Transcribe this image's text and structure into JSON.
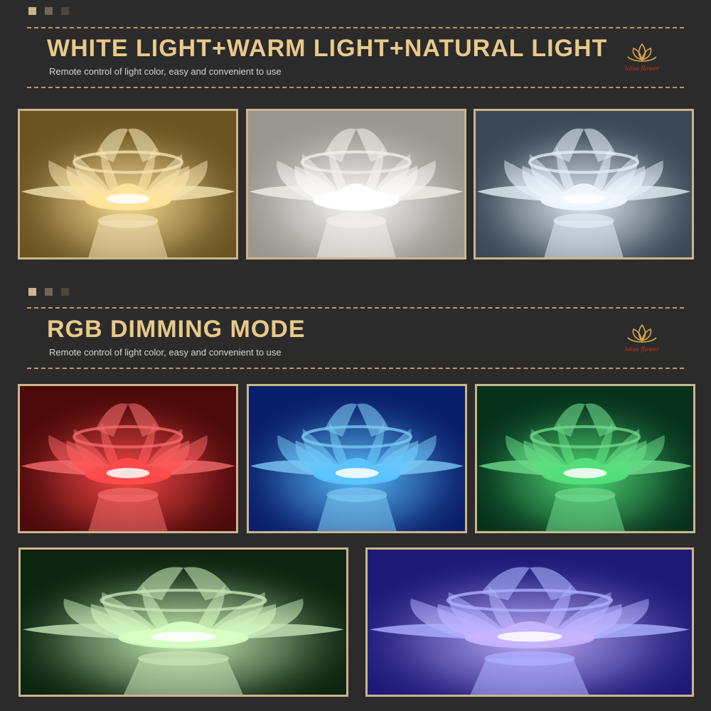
{
  "section1": {
    "title": "WHITE LIGHT+WARM LIGHT+NATURAL LIGHT",
    "subtitle": "Remote control of light color, easy and convenient to use",
    "brand": "lotus flower",
    "photos": [
      {
        "name": "warm-light-lotus-lamp",
        "bg": "#6b5422",
        "glow": "#ffe39b",
        "petal": "#f4e2b3"
      },
      {
        "name": "natural-light-lotus-lamp",
        "bg": "#9a9690",
        "glow": "#ffffff",
        "petal": "#f1efea"
      },
      {
        "name": "white-light-lotus-lamp",
        "bg": "#3c4856",
        "glow": "#eef6ff",
        "petal": "#e2ecf5"
      }
    ]
  },
  "section2": {
    "title": "RGB DIMMING MODE",
    "subtitle": "Remote control of light color, easy and convenient to use",
    "brand": "lotus flower",
    "photos": [
      {
        "name": "red-light-lotus-lamp",
        "bg": "#4d0a0a",
        "glow": "#ff4a4a",
        "petal": "#f26a6a"
      },
      {
        "name": "blue-light-lotus-lamp",
        "bg": "#0a1f6b",
        "glow": "#5cc4ff",
        "petal": "#7cc8f2"
      },
      {
        "name": "green-light-lotus-lamp",
        "bg": "#06321c",
        "glow": "#53e07a",
        "petal": "#6ed88a"
      },
      {
        "name": "mint-green-light-lotus-lamp",
        "bg": "#0d2410",
        "glow": "#d8ffc4",
        "petal": "#c6e4b6"
      },
      {
        "name": "violet-light-lotus-lamp",
        "bg": "#1d1a78",
        "glow": "#c6b4ff",
        "petal": "#aeb0ff"
      }
    ]
  },
  "colors": {
    "background": "#2b2b2b",
    "title": "#e9c98a",
    "dashes": "#b89a66",
    "frame": "#cbb58b",
    "brand": "#c8361e"
  }
}
